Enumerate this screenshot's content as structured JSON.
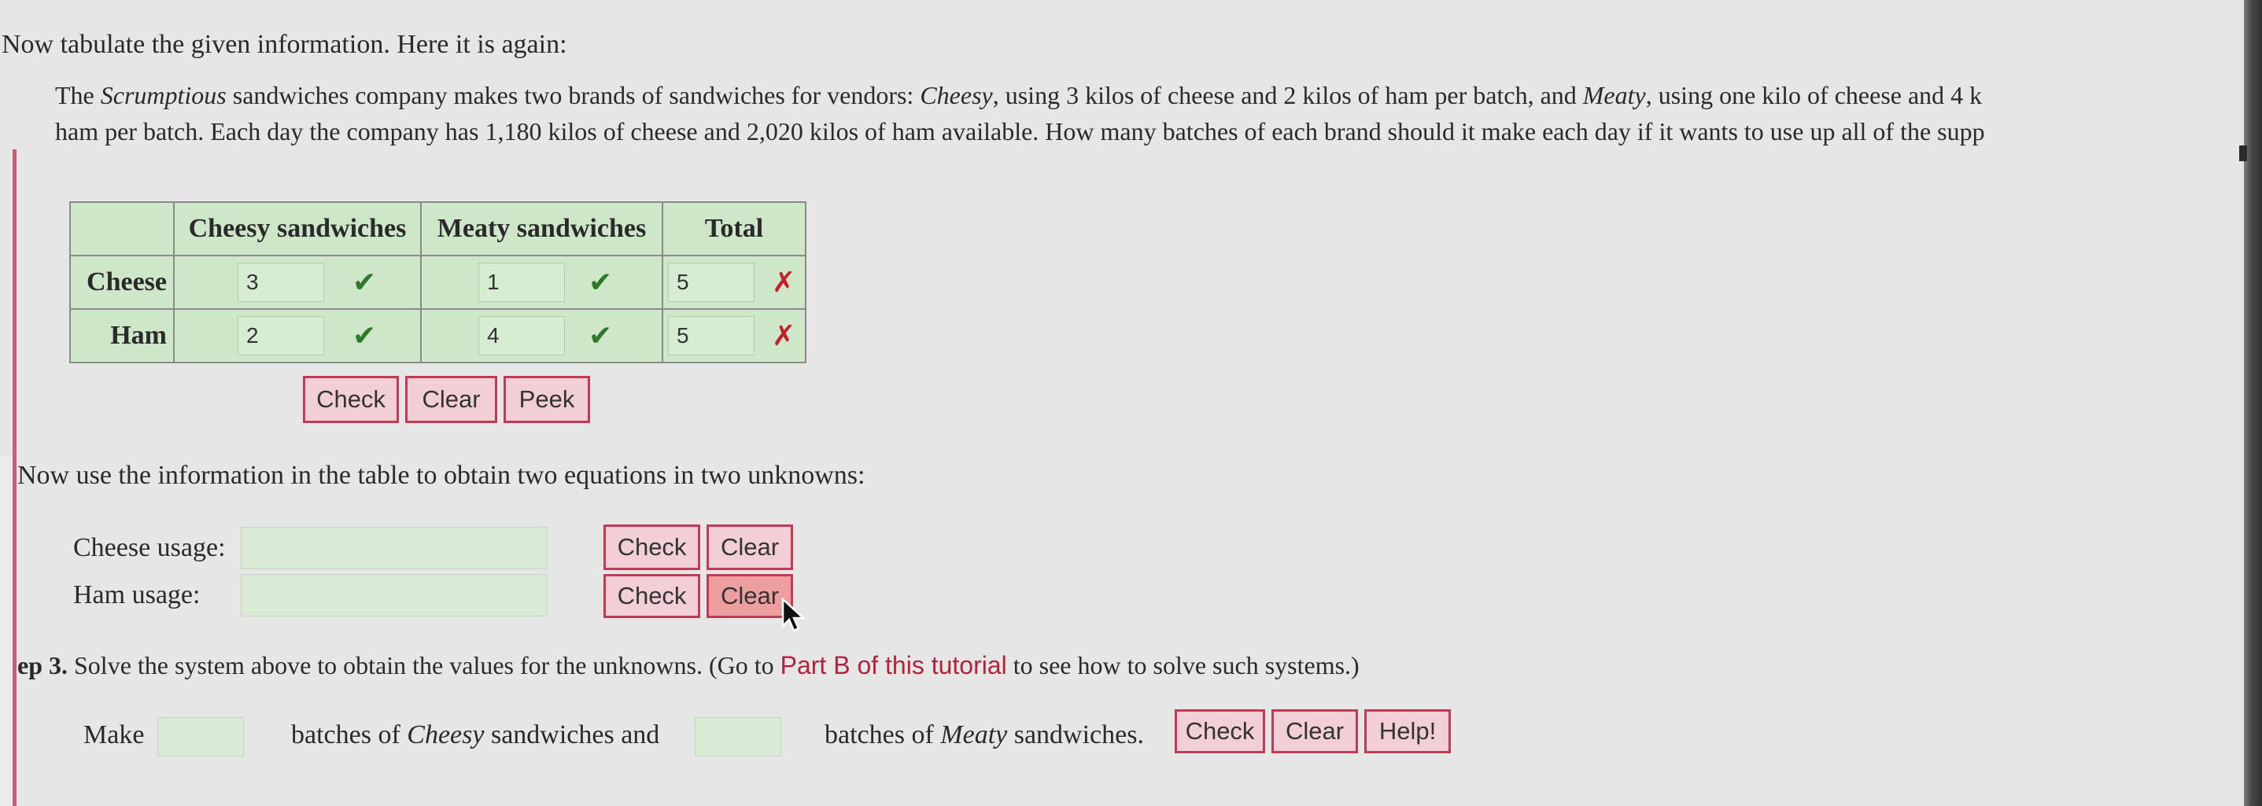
{
  "intro": "Now tabulate the given information. Here it is again:",
  "problem": {
    "line1_a": "The ",
    "company": "Scrumptious",
    "line1_b": " sandwiches company makes two brands of sandwiches for vendors: ",
    "brand1": "Cheesy",
    "line1_c": ", using 3 kilos of cheese and 2 kilos of ham per batch, and ",
    "brand2": "Meaty",
    "line1_d": ", using one kilo of cheese and 4 k",
    "line2": "ham per batch. Each day the company has 1,180 kilos of cheese and 2,020 kilos of ham available. How many batches of each brand should it make each day if it wants to use up all of the supp"
  },
  "table": {
    "headers": [
      "",
      "Cheesy sandwiches",
      "Meaty sandwiches",
      "Total"
    ],
    "rows": [
      {
        "label": "Cheese",
        "cells": [
          {
            "value": "3",
            "status": "✔"
          },
          {
            "value": "1",
            "status": "✔"
          },
          {
            "value": "5",
            "status": "✗"
          }
        ]
      },
      {
        "label": "Ham",
        "cells": [
          {
            "value": "2",
            "status": "✔"
          },
          {
            "value": "4",
            "status": "✔"
          },
          {
            "value": "5",
            "status": "✗"
          }
        ]
      }
    ],
    "buttons": {
      "check": "Check",
      "clear": "Clear",
      "peek": "Peek"
    }
  },
  "equations": {
    "prompt": "Now use the information in the table to obtain two equations in two unknowns:",
    "cheese_label": "Cheese usage:",
    "ham_label": "Ham usage:",
    "cheese_value": "",
    "ham_value": "",
    "check": "Check",
    "clear": "Clear"
  },
  "step3": {
    "prefix": "ep 3.",
    "text": " Solve the system above to obtain the values for the unknowns. (Go to ",
    "link": "Part B of this tutorial",
    "suffix": " to see how to solve such systems.)",
    "make": "Make",
    "mid_a": "batches of ",
    "brand1": "Cheesy",
    "mid_b": " sandwiches and",
    "end_a": "batches of ",
    "brand2": "Meaty",
    "end_b": " sandwiches.",
    "value1": "",
    "value2": "",
    "check": "Check",
    "clear": "Clear",
    "help": "Help!"
  },
  "colors": {
    "table_bg": "#cfe7c9",
    "button_bg": "#f2cfd6",
    "button_border": "#c13b56",
    "button_hover": "#ed9f9f",
    "correct": "#2f7a2a",
    "incorrect": "#c4202a",
    "link": "#b1223b"
  }
}
